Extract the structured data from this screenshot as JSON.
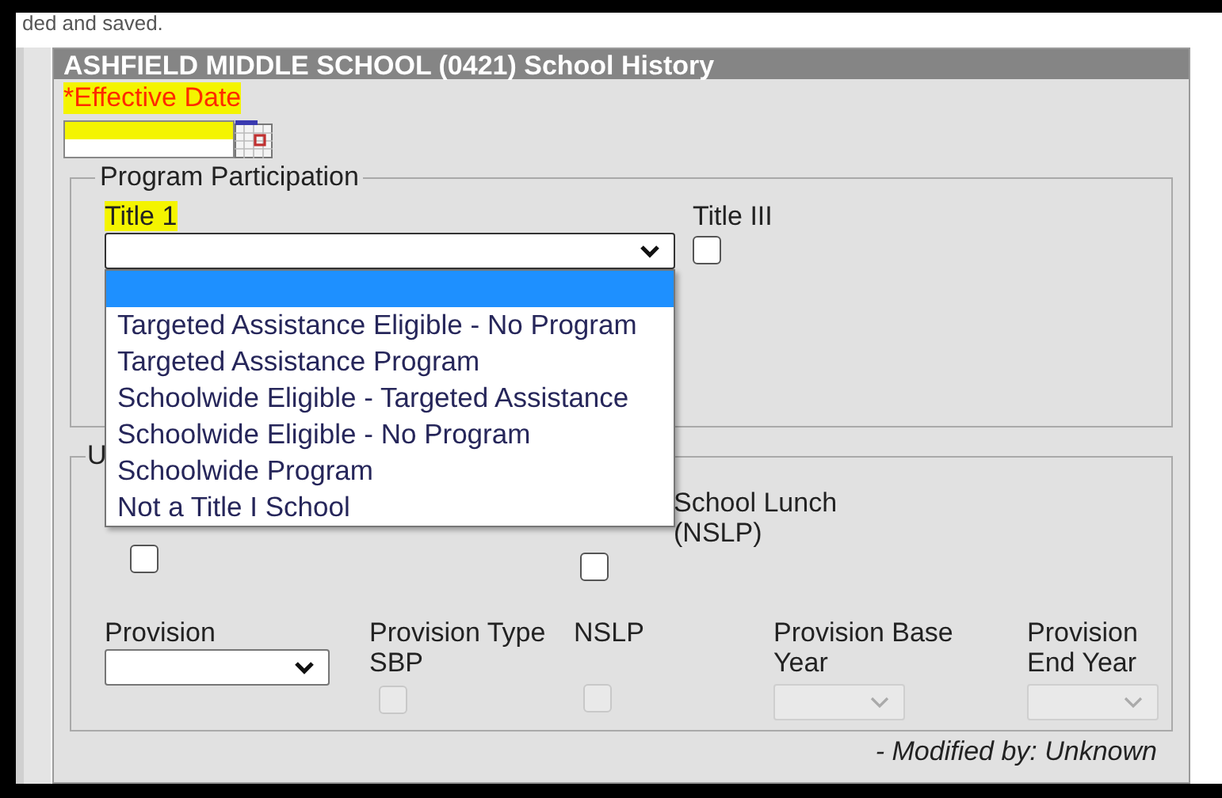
{
  "top_note": "ded and saved.",
  "panel": {
    "title": "ASHFIELD MIDDLE SCHOOL (0421) School History",
    "effective_date": {
      "label": "*Effective Date",
      "required": true,
      "highlighted": true
    },
    "program_participation": {
      "legend": "Program Participation",
      "title_1": {
        "label": "Title 1",
        "highlighted": true,
        "open": true,
        "options": [
          {
            "selected": true
          },
          {
            "text": "Targeted Assistance Eligible - No Program",
            "selected": false
          },
          {
            "text": "Targeted Assistance Program",
            "selected": false
          },
          {
            "text": "Schoolwide Eligible - Targeted Assistance",
            "selected": false
          },
          {
            "text": "Schoolwide Eligible - No Program",
            "selected": false
          },
          {
            "text": "Schoolwide Program",
            "selected": false
          },
          {
            "text": "Not a Title I School",
            "selected": false
          }
        ]
      },
      "title_3": {
        "label": "Title III",
        "checked": false
      }
    },
    "lunch": {
      "legend": "U",
      "items": [
        {
          "checked": false
        },
        {
          "label_lines": [
            "School Lunch",
            "(NSLP)"
          ],
          "checked": false
        }
      ],
      "provision_fields": [
        {
          "kind": "select",
          "label_lines": [
            "Provision"
          ],
          "disabled": false
        },
        {
          "kind": "checkbox",
          "label_lines": [
            "Provision Type",
            "SBP"
          ],
          "disabled": true,
          "checked": false
        },
        {
          "kind": "checkbox",
          "label_lines": [
            "NSLP"
          ],
          "disabled": true,
          "checked": false
        },
        {
          "kind": "select",
          "label_lines": [
            "Provision Base",
            "Year"
          ],
          "disabled": true
        },
        {
          "kind": "select",
          "label_lines": [
            "Provision",
            "End Year"
          ],
          "disabled": true
        }
      ]
    },
    "modified": "- Modified by: Unknown"
  }
}
